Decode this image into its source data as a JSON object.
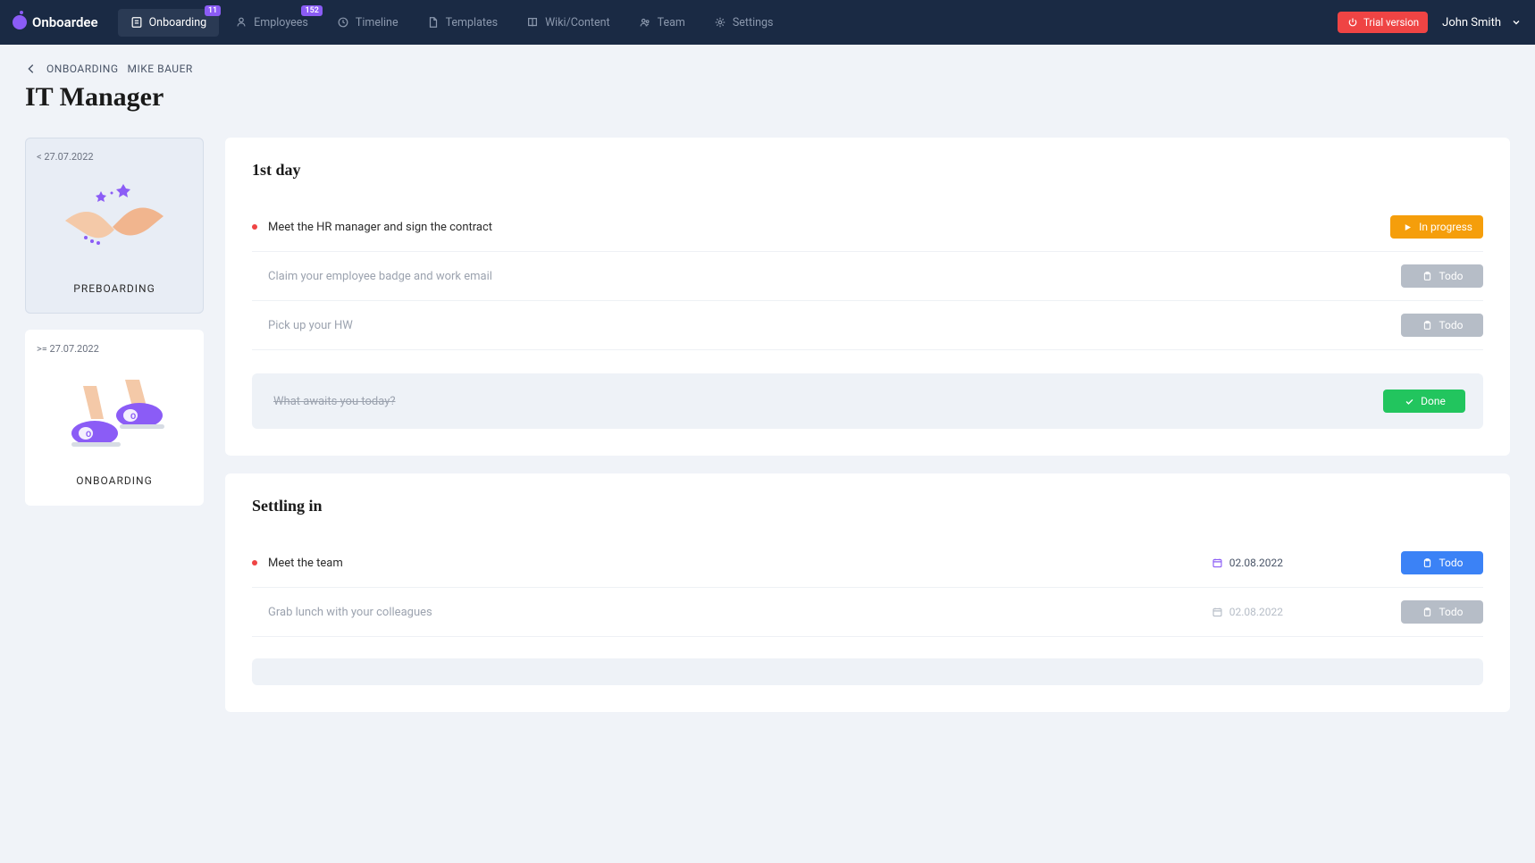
{
  "brand": "Onboardee",
  "nav": {
    "items": [
      {
        "label": "Onboarding",
        "badge": "11"
      },
      {
        "label": "Employees",
        "badge": "152"
      },
      {
        "label": "Timeline"
      },
      {
        "label": "Templates"
      },
      {
        "label": "Wiki/Content"
      },
      {
        "label": "Team"
      },
      {
        "label": "Settings"
      }
    ],
    "trial": "Trial version",
    "user": "John Smith"
  },
  "breadcrumb": {
    "back_aria": "Back",
    "parent": "ONBOARDING",
    "child": "MIKE BAUER"
  },
  "page_title": "IT Manager",
  "phases": [
    {
      "date": "< 27.07.2022",
      "label": "PREBOARDING"
    },
    {
      "date": ">= 27.07.2022",
      "label": "ONBOARDING"
    }
  ],
  "sections": [
    {
      "title": "1st day",
      "tasks": [
        {
          "text": "Meet the HR manager and sign the contract",
          "marked": true,
          "status": "In progress",
          "kind": "progress"
        },
        {
          "text": "Claim your employee badge and work email",
          "marked": false,
          "status": "Todo",
          "kind": "todo-grey"
        },
        {
          "text": "Pick up your HW",
          "marked": false,
          "status": "Todo",
          "kind": "todo-grey"
        }
      ],
      "done": {
        "text": "What awaits you today?",
        "status": "Done"
      }
    },
    {
      "title": "Settling in",
      "tasks": [
        {
          "text": "Meet the team",
          "marked": true,
          "date": "02.08.2022",
          "status": "Todo",
          "kind": "todo-blue"
        },
        {
          "text": "Grab lunch with your colleagues",
          "marked": false,
          "date": "02.08.2022",
          "status": "Todo",
          "kind": "todo-grey"
        }
      ]
    }
  ]
}
